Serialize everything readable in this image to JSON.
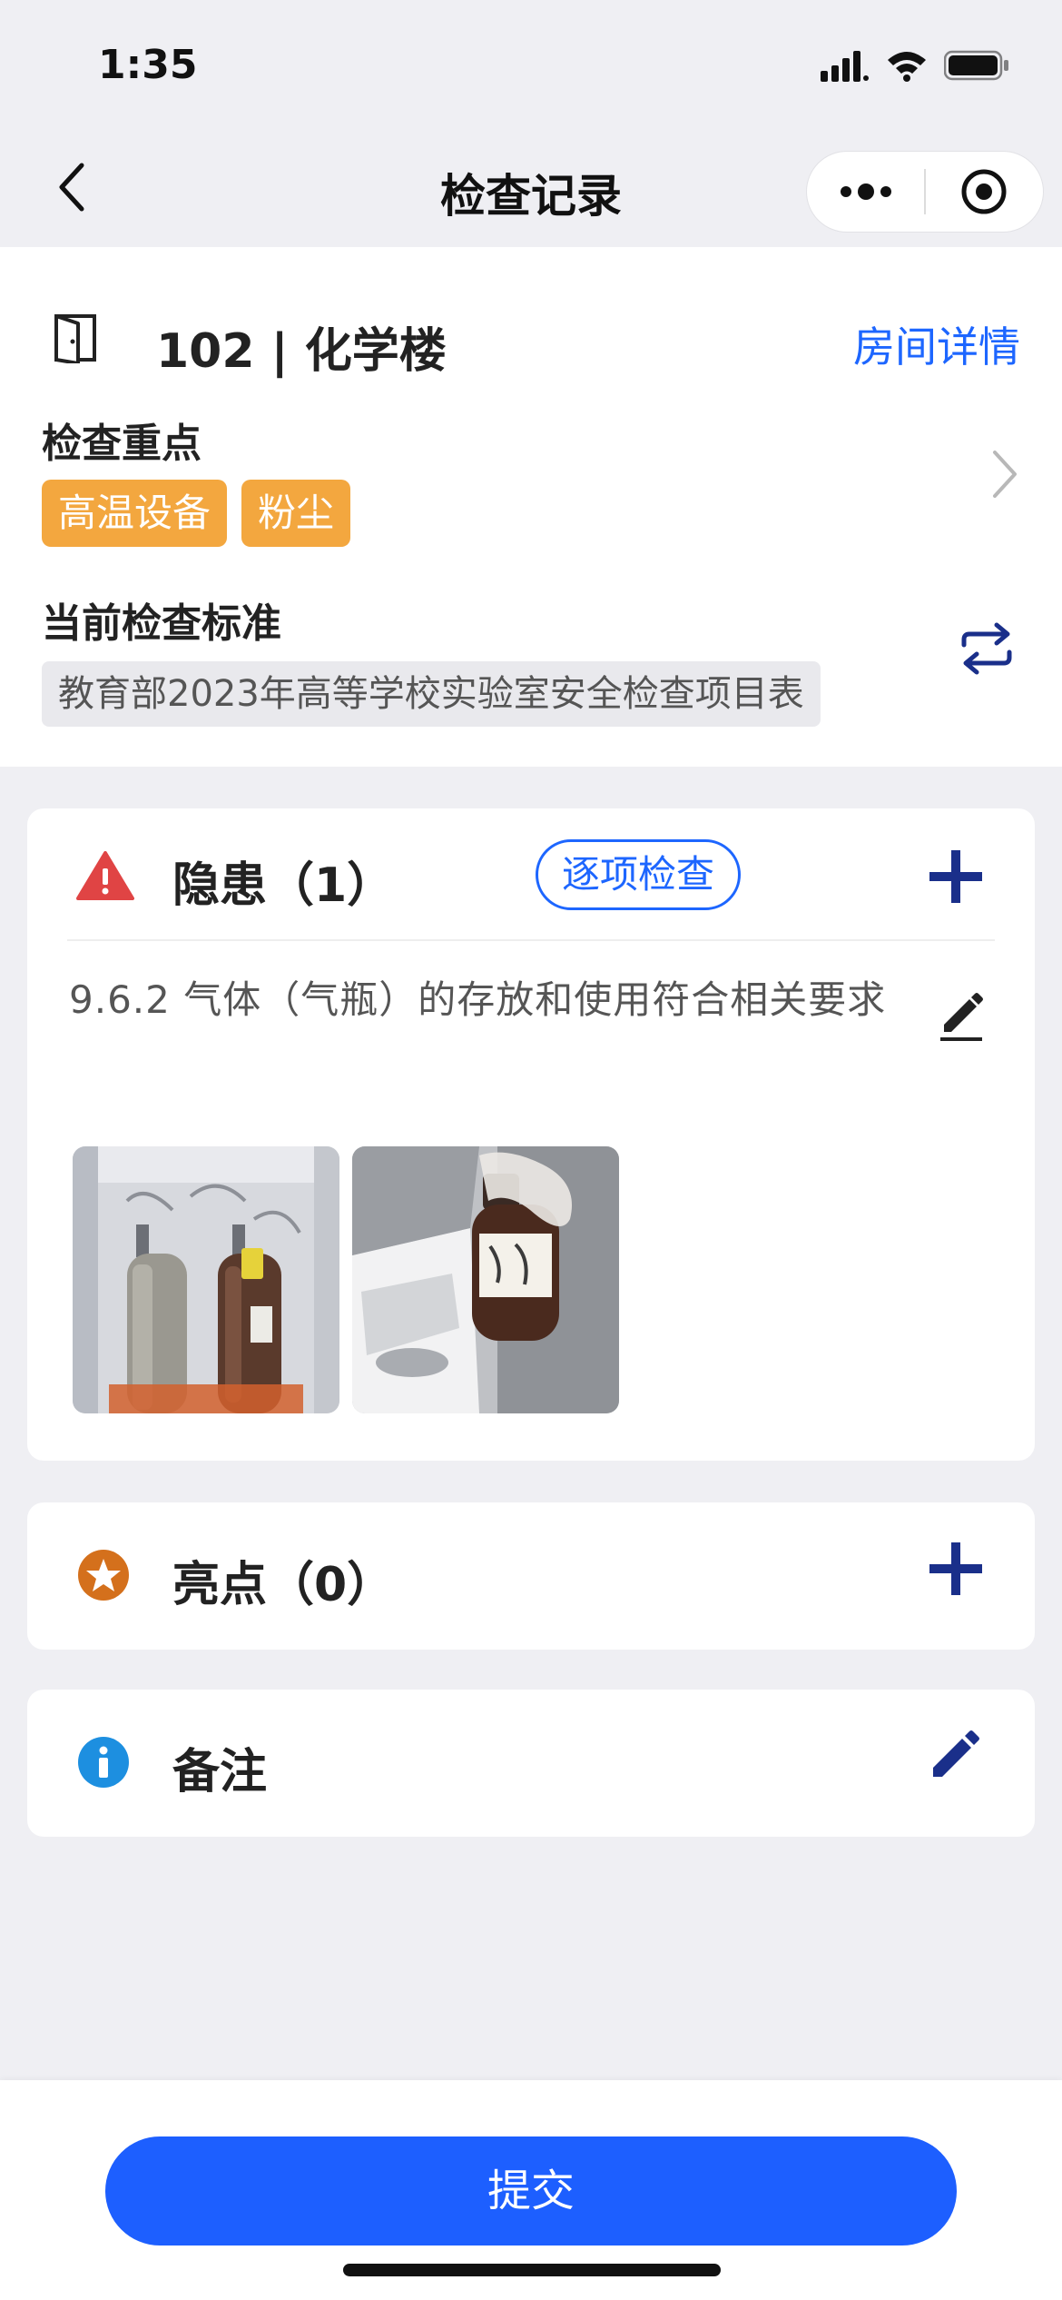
{
  "status_bar": {
    "time": "1:35"
  },
  "nav": {
    "title": "检查记录"
  },
  "room": {
    "name": "102 | 化学楼",
    "detail_link": "房间详情"
  },
  "focus": {
    "label": "检查重点",
    "tags": [
      "高温设备",
      "粉尘"
    ]
  },
  "standard": {
    "label": "当前检查标准",
    "value": "教育部2023年高等学校实验室安全检查项目表"
  },
  "hazard": {
    "title": "隐患（1）",
    "check_each": "逐项检查",
    "items": [
      {
        "text": "9.6.2 气体（气瓶）的存放和使用符合相关要求"
      }
    ]
  },
  "highlight": {
    "title": "亮点（0）"
  },
  "note": {
    "title": "备注"
  },
  "footer": {
    "submit": "提交"
  },
  "colors": {
    "accent": "#1d66ff",
    "tag": "#f3a73f",
    "hazard_icon": "#e04444",
    "highlight_icon": "#d4701c",
    "info_icon": "#1d8fe0",
    "action_icon": "#1a2f8a"
  }
}
